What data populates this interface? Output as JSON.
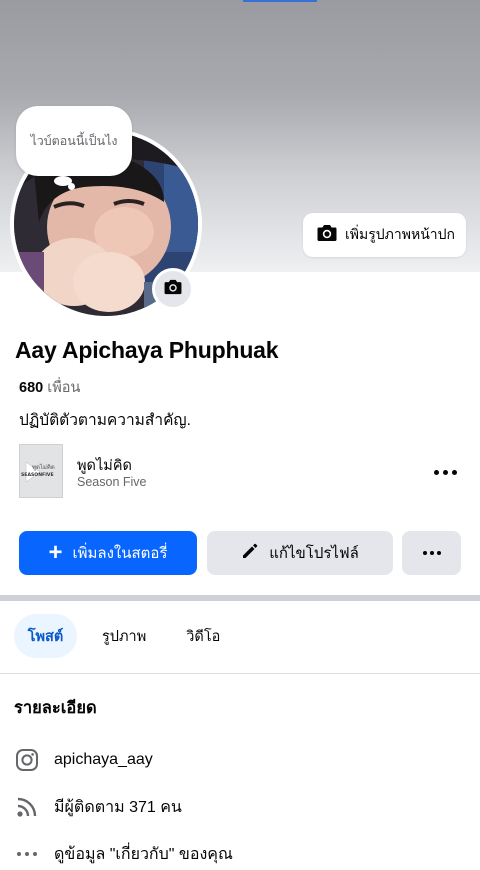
{
  "cover": {
    "add_cover_label": "เพิ่มรูปภาพหน้าปก"
  },
  "note": {
    "text": "ไวบ์ตอนนี้เป็นไง"
  },
  "profile": {
    "name": "Aay Apichaya Phuphuak",
    "friends_count": "680",
    "friends_label": "เพื่อน",
    "bio": "ปฏิบัติตัวตามความสำคัญ."
  },
  "music": {
    "title": "พูดไม่คิด",
    "artist": "Season Five",
    "thumb_text_top": "พูดไม่คิด",
    "thumb_text_bottom": "SEASONFIVE"
  },
  "actions": {
    "add_story": "เพิ่มลงในสตอรี่",
    "edit_profile": "แก้ไขโปรไฟล์"
  },
  "tabs": [
    {
      "label": "โพสต์",
      "active": true
    },
    {
      "label": "รูปภาพ",
      "active": false
    },
    {
      "label": "วิดีโอ",
      "active": false
    }
  ],
  "details": {
    "heading": "รายละเอียด",
    "instagram": "apichaya_aay",
    "followers": "มีผู้ติดตาม 371 คน",
    "about": "ดูข้อมูล \"เกี่ยวกับ\" ของคุณ"
  },
  "colors": {
    "primary": "#0866ff",
    "tab_active_bg": "#ebf5ff",
    "button_gray": "#e4e6eb"
  }
}
